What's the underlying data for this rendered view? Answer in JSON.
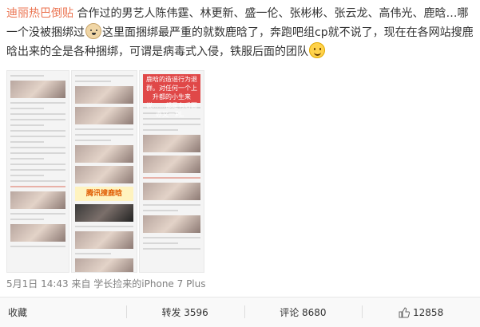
{
  "post": {
    "tag": "迪丽热巴倒贴",
    "text_part1": "合作过的男艺人陈伟霆、林更新、盛一伦、张彬彬、张云龙、高伟光、鹿晗…哪一个没被捆绑过",
    "text_part2": "这里面捆绑最严重的就数鹿晗了，奔跑吧组cp就不说了，现在在各网站搜鹿晗出来的全是各种捆绑，可谓是病毒式入侵，铁服后面的团队",
    "emoji1": "dog-emoji",
    "emoji2": "smile-emoji"
  },
  "thumbnails": {
    "t2_banner": "腾讯搜鹿晗",
    "t3_banner": "鹿晗的造谣行为退群。对任何一个上升都的小生来说……都是有后面亦又一利。"
  },
  "meta": {
    "time_source": "5月1日 14:43 来自 学长捡来的iPhone 7 Plus"
  },
  "actions": {
    "collect": "收藏",
    "repost": "转发 3596",
    "comment": "评论 8680",
    "like": "12858"
  },
  "colors": {
    "tag": "#eb7350",
    "meta": "#808080"
  }
}
